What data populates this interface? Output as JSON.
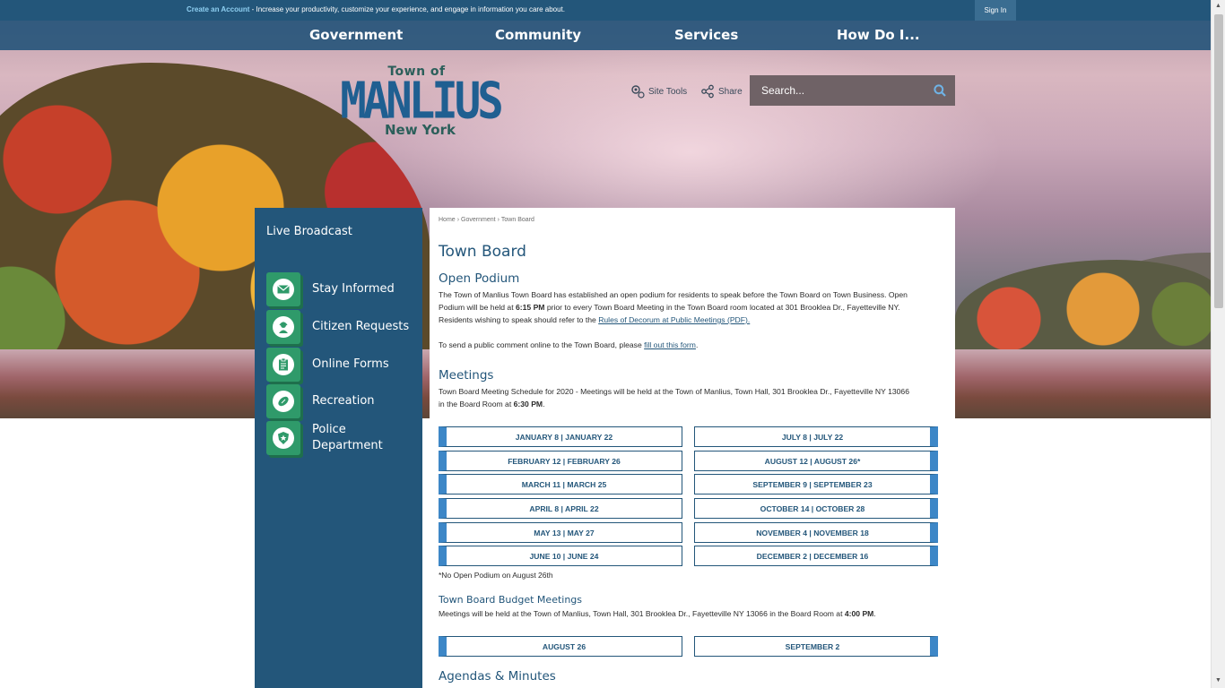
{
  "topbar": {
    "create_account": "Create an Account",
    "tagline": " - Increase your productivity, customize your experience, and engage in information you care about.",
    "sign_in": "Sign In"
  },
  "nav": {
    "items": [
      "Government",
      "Community",
      "Services",
      "How Do I..."
    ]
  },
  "logo": {
    "line1": "Town of",
    "line2": "MANLIUS",
    "line3": "New York"
  },
  "tools": {
    "site_tools": "Site Tools",
    "share": "Share"
  },
  "search": {
    "placeholder": "Search..."
  },
  "sidebar": {
    "live_broadcast": "Live Broadcast",
    "quick_links": [
      {
        "label": "Stay Informed",
        "icon": "envelope-icon"
      },
      {
        "label": "Citizen Requests",
        "icon": "person-headset-icon"
      },
      {
        "label": "Online Forms",
        "icon": "clipboard-icon"
      },
      {
        "label": "Recreation",
        "icon": "football-icon"
      },
      {
        "label": "Police Department",
        "icon": "police-badge-icon"
      }
    ]
  },
  "breadcrumb": {
    "home": "Home",
    "government": "Government",
    "current": "Town Board",
    "separator": "›"
  },
  "page": {
    "title": "Town Board",
    "open_podium": {
      "heading": "Open Podium",
      "p1_a": "The Town of Manlius Town Board has established an open podium for residents to speak before the Town Board on Town Business. Open Podium will be held at ",
      "p1_time": "6:15 PM",
      "p1_b": " prior to every Town Board Meeting in the Town Board room located at 301 Brooklea Dr., Fayetteville NY. Residents wishing to speak should refer to the ",
      "p1_link": "Rules of Decorum at Public Meetings (PDF).",
      "p2_a": "To send a public comment online to the Town Board, please ",
      "p2_link": "fill out this form",
      "p2_b": "."
    },
    "meetings": {
      "heading": "Meetings",
      "text_a": "Town Board Meeting Schedule for 2020 - Meetings will be held at the Town of Manlius, Town Hall, 301 Brooklea Dr., Fayetteville NY 13066 in the Board Room at ",
      "time": "6:30 PM",
      "text_b": ".",
      "left_dates": [
        "JANUARY 8  |  JANUARY 22",
        "FEBRUARY 12  |  FEBRUARY 26",
        "MARCH 11  |  MARCH 25",
        "APRIL 8  |  APRIL 22",
        "MAY 13  |  MAY 27",
        "JUNE 10  |  JUNE 24"
      ],
      "right_dates": [
        "JULY 8  |  JULY 22",
        "AUGUST 12  |  AUGUST 26*",
        "SEPTEMBER 9  |  SEPTEMBER 23",
        "OCTOBER 14  |  OCTOBER 28",
        "NOVEMBER 4  |  NOVEMBER 18",
        "DECEMBER 2  |  DECEMBER 16"
      ],
      "note": "*No Open Podium on August 26th"
    },
    "budget": {
      "heading": "Town Board Budget Meetings",
      "text_a": "Meetings will be held at the Town of Manlius, Town Hall, 301 Brooklea Dr., Fayetteville NY 13066 in the Board Room at ",
      "time": "4:00 PM",
      "text_b": ".",
      "dates": [
        "AUGUST 26",
        "SEPTEMBER 2"
      ]
    },
    "agendas": {
      "heading": "Agendas & Minutes"
    }
  },
  "colors": {
    "brand_blue": "#23567a",
    "accent_blue": "#3d87c7",
    "icon_green": "#2f9a6a"
  }
}
